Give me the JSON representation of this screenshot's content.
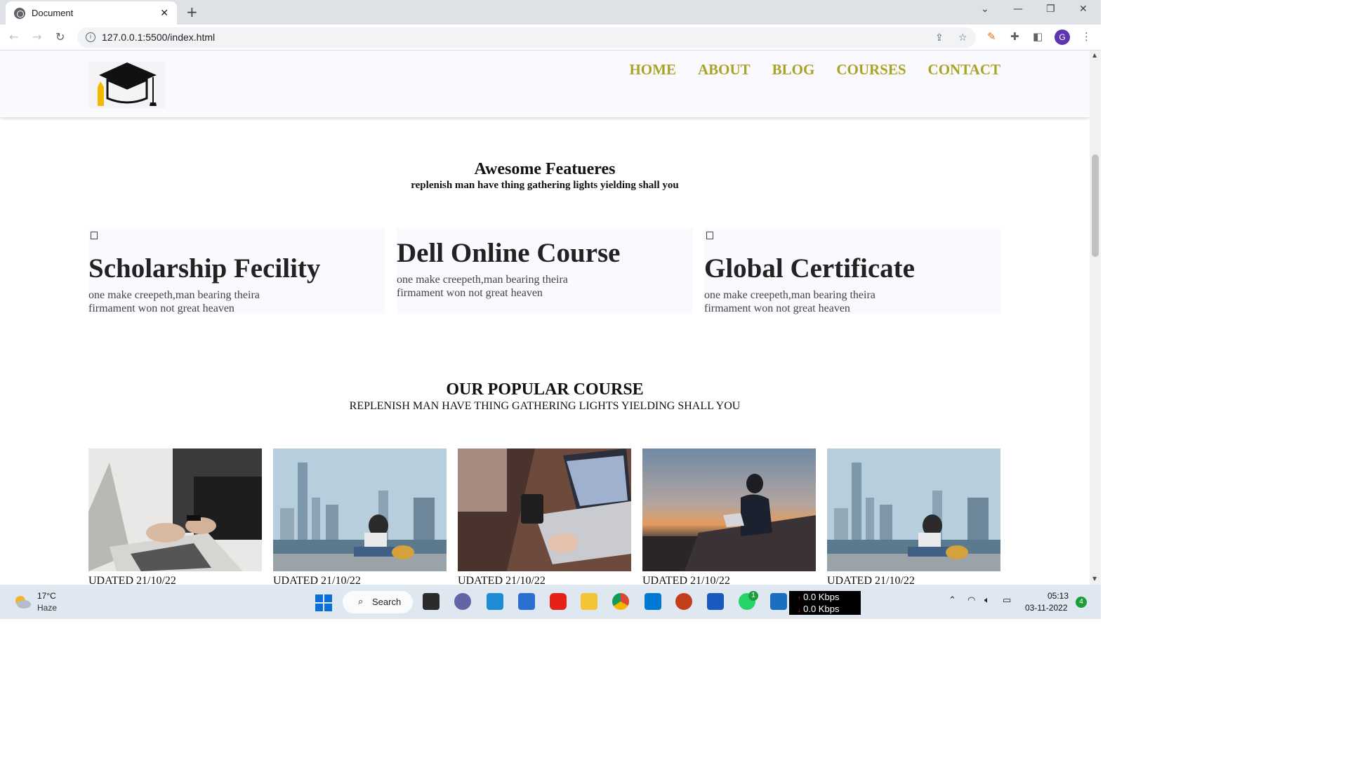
{
  "browser": {
    "tab_title": "Document",
    "tab_close": "✕",
    "new_tab": "+",
    "url": "127.0.0.1:5500/index.html",
    "window_controls": [
      "⌄",
      "—",
      "❐",
      "✕"
    ],
    "profile_initial": "G"
  },
  "site": {
    "nav": [
      "HOME",
      "ABOUT",
      "BLOG",
      "COURSES",
      "CONTACT"
    ],
    "nav_color": "#a9a326",
    "features": {
      "title": "Awesome Featueres",
      "subtitle": "replenish man have thing gathering lights yielding shall you",
      "cards": [
        {
          "title": "Scholarship Fecility",
          "text": "one make creepeth,man bearing theira firmament won not great heaven"
        },
        {
          "title": "Dell Online Course",
          "text": "one make creepeth,man bearing theira firmament won not great heaven"
        },
        {
          "title": "Global Certificate",
          "text": "one make creepeth,man bearing theira firmament won not great heaven"
        }
      ]
    },
    "popular": {
      "title": "OUR POPULAR COURSE",
      "subtitle": "REPLENISH MAN HAVE THING GATHERING LIGHTS YIELDING SHALL YOU",
      "courses": [
        {
          "date": "UDATED 21/10/22"
        },
        {
          "date": "UDATED 21/10/22"
        },
        {
          "date": "UDATED 21/10/22"
        },
        {
          "date": "UDATED 21/10/22"
        },
        {
          "date": "UDATED 21/10/22"
        }
      ]
    }
  },
  "taskbar": {
    "temperature": "17°C",
    "condition": "Haze",
    "search_label": "Search",
    "whatsapp_badge": "1",
    "net_up": "0.0 Kbps",
    "net_down": "0.0 Kbps",
    "time": "05:13",
    "date": "03-11-2022",
    "notifications": "4"
  }
}
